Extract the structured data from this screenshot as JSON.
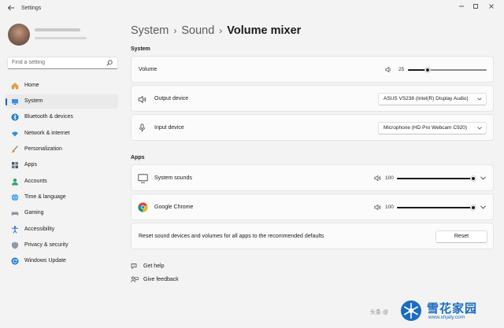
{
  "window": {
    "title": "Settings"
  },
  "search": {
    "placeholder": "Find a setting"
  },
  "sidebar": {
    "items": [
      {
        "label": "Home",
        "icon": "home-icon"
      },
      {
        "label": "System",
        "icon": "system-icon",
        "active": true
      },
      {
        "label": "Bluetooth & devices",
        "icon": "bluetooth-icon"
      },
      {
        "label": "Network & internet",
        "icon": "wifi-icon"
      },
      {
        "label": "Personalization",
        "icon": "brush-icon"
      },
      {
        "label": "Apps",
        "icon": "apps-icon"
      },
      {
        "label": "Accounts",
        "icon": "accounts-icon"
      },
      {
        "label": "Time & language",
        "icon": "globe-icon"
      },
      {
        "label": "Gaming",
        "icon": "gamepad-icon"
      },
      {
        "label": "Accessibility",
        "icon": "accessibility-icon"
      },
      {
        "label": "Privacy & security",
        "icon": "shield-icon"
      },
      {
        "label": "Windows Update",
        "icon": "update-icon"
      }
    ]
  },
  "breadcrumb": {
    "part1": "System",
    "part2": "Sound",
    "current": "Volume mixer",
    "separator": "›"
  },
  "system_section": {
    "heading": "System",
    "volume": {
      "label": "Volume",
      "value": "25",
      "level": 0.25
    },
    "output": {
      "label": "Output device",
      "selected": "ASUS VS238 (Intel(R) Display Audio)"
    },
    "input": {
      "label": "Input device",
      "selected": "Microphone (HD Pro Webcam C920)"
    }
  },
  "apps_section": {
    "heading": "Apps",
    "apps": [
      {
        "label": "System sounds",
        "value": "100",
        "level": 1.0,
        "icon": "monitor-icon"
      },
      {
        "label": "Google Chrome",
        "value": "100",
        "level": 1.0,
        "icon": "chrome-icon"
      }
    ],
    "reset_text": "Reset sound devices and volumes for all apps to the recommended defaults",
    "reset_label": "Reset"
  },
  "links": {
    "help": "Get help",
    "feedback": "Give feedback"
  },
  "watermark": {
    "title": "雪花家园",
    "url": "www.xhjaty.com",
    "left_text": "头条 @"
  },
  "colors": {
    "accent": "#0067c0",
    "background": "#f3f3f3",
    "card": "#fbfbfb"
  }
}
